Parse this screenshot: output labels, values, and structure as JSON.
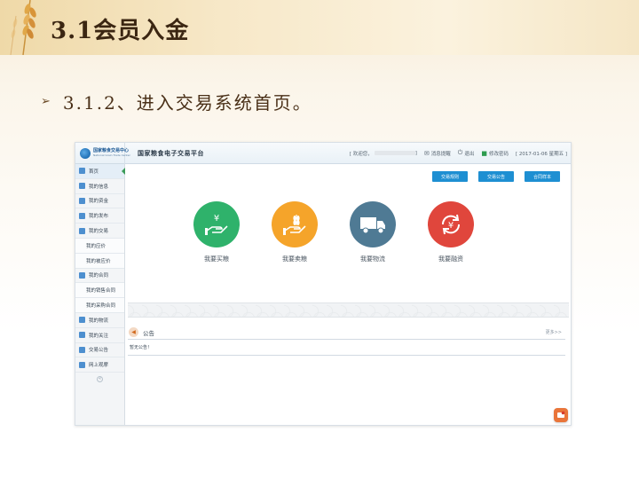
{
  "slide": {
    "title": "3.1会员入金",
    "bullet": "➢",
    "subtitle": "3.1.2、进入交易系统首页。"
  },
  "app": {
    "logo": {
      "cn": "国家粮食交易中心",
      "en": "National Grain Trade Center"
    },
    "platform_title": "国家粮食电子交易平台",
    "header": {
      "welcome": "[ 欢迎您，",
      "welcome_end": "]",
      "messages": "消息提醒",
      "logout": "退出",
      "change_password": "修改密码",
      "date": "[ 2017-01-06 星期五 ]"
    },
    "sidebar": {
      "items": [
        {
          "label": "首页",
          "type": "main"
        },
        {
          "label": "我的信息",
          "type": "main"
        },
        {
          "label": "我的资金",
          "type": "main"
        },
        {
          "label": "我的发布",
          "type": "main"
        },
        {
          "label": "我的交易",
          "type": "main"
        },
        {
          "label": "我的应价",
          "type": "sub"
        },
        {
          "label": "我的被应价",
          "type": "sub"
        },
        {
          "label": "我的合同",
          "type": "main"
        },
        {
          "label": "我的销售合同",
          "type": "sub"
        },
        {
          "label": "我的采购合同",
          "type": "sub"
        },
        {
          "label": "我的物流",
          "type": "main"
        },
        {
          "label": "我的关注",
          "type": "main"
        },
        {
          "label": "交易公告",
          "type": "main"
        },
        {
          "label": "网上观摩",
          "type": "main"
        }
      ]
    },
    "toolbar": {
      "rules": "交易规则",
      "announcements": "交易公告",
      "contract_template": "合同样本"
    },
    "actions": [
      {
        "label": "我要买粮",
        "color": "#2fb26b",
        "icon": "hand-yen-icon"
      },
      {
        "label": "我要卖粮",
        "color": "#f5a42a",
        "icon": "hand-wheat-icon"
      },
      {
        "label": "我要物流",
        "color": "#4f7a94",
        "icon": "truck-icon"
      },
      {
        "label": "我要融资",
        "color": "#e0463c",
        "icon": "yen-cycle-icon"
      }
    ],
    "notice": {
      "title": "公告",
      "more": "更多>>",
      "empty": "暂无公告！"
    }
  }
}
